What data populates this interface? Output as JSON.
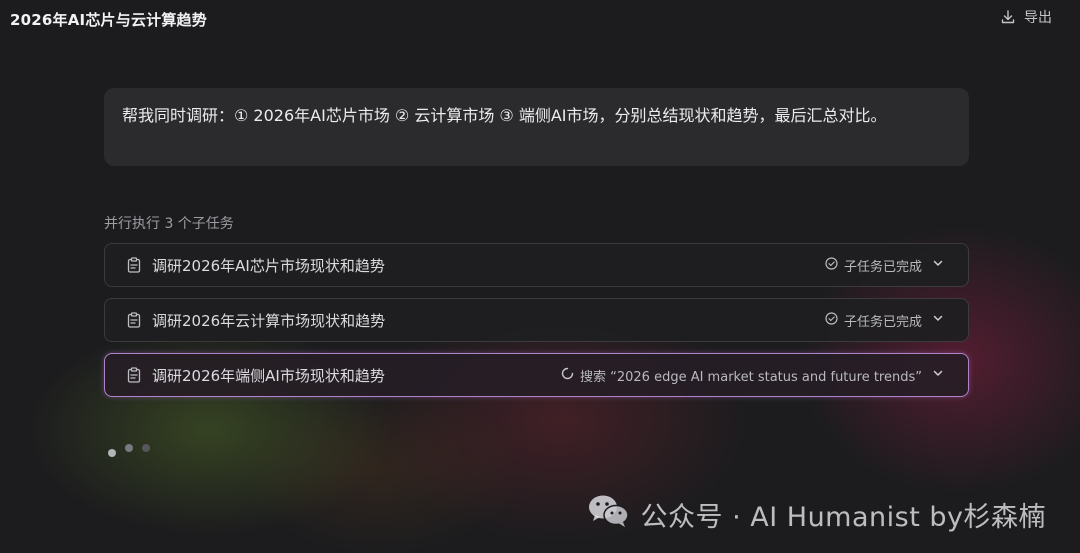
{
  "app": {
    "title": "2026年AI芯片与云计算趋势"
  },
  "toolbar": {
    "export_label": "导出",
    "export_icon": "download-icon"
  },
  "prompt": {
    "text": "帮我同时调研：① 2026年AI芯片市场 ② 云计算市场 ③ 端侧AI市场，分别总结现状和趋势，最后汇总对比。"
  },
  "section": {
    "label": "并行执行 3 个子任务"
  },
  "tasks": [
    {
      "label": "调研2026年AI芯片市场现状和趋势",
      "status": "子任务已完成",
      "status_icon": "check-circle-icon",
      "state": "done"
    },
    {
      "label": "调研2026年云计算市场现状和趋势",
      "status": "子任务已完成",
      "status_icon": "check-circle-icon",
      "state": "done"
    },
    {
      "label": "调研2026年端侧AI市场现状和趋势",
      "status": "搜索 “2026 edge AI market status and future trends”",
      "status_icon": "spinner-icon",
      "state": "running"
    }
  ],
  "pagination": {
    "count": 3,
    "active": 1
  },
  "watermark": {
    "text": "公众号 · AI Humanist by杉森楠",
    "icon": "wechat-icon"
  },
  "colors": {
    "background": "#1c1c1e",
    "card": "#2b2b2e",
    "active_border": "#c896e6",
    "text": "#e8e8ea",
    "muted": "#9c9ca2"
  }
}
